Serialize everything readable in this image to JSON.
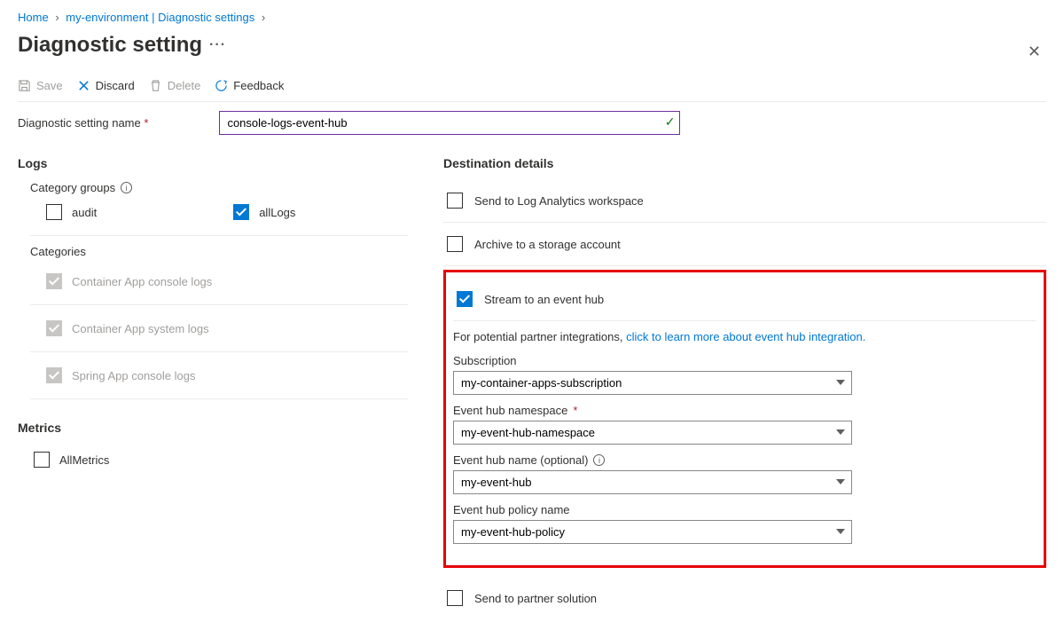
{
  "breadcrumb": {
    "home": "Home",
    "env": "my-environment | Diagnostic settings"
  },
  "page_title": "Diagnostic setting",
  "toolbar": {
    "save": "Save",
    "discard": "Discard",
    "delete": "Delete",
    "feedback": "Feedback"
  },
  "name_field": {
    "label": "Diagnostic setting name",
    "value": "console-logs-event-hub"
  },
  "logs": {
    "heading": "Logs",
    "category_groups_label": "Category groups",
    "audit": "audit",
    "allLogs": "allLogs",
    "categories_label": "Categories",
    "cats": [
      "Container App console logs",
      "Container App system logs",
      "Spring App console logs"
    ]
  },
  "metrics": {
    "heading": "Metrics",
    "all": "AllMetrics"
  },
  "dest": {
    "heading": "Destination details",
    "law": "Send to Log Analytics workspace",
    "storage": "Archive to a storage account",
    "eventhub": "Stream to an event hub",
    "eh_note_pre": "For potential partner integrations, ",
    "eh_note_link": "click to learn more about event hub integration.",
    "sub_label": "Subscription",
    "sub_value": "my-container-apps-subscription",
    "ns_label": "Event hub namespace",
    "ns_value": "my-event-hub-namespace",
    "name_label": "Event hub name (optional)",
    "name_value": "my-event-hub",
    "policy_label": "Event hub policy name",
    "policy_value": "my-event-hub-policy",
    "partner": "Send to partner solution"
  }
}
